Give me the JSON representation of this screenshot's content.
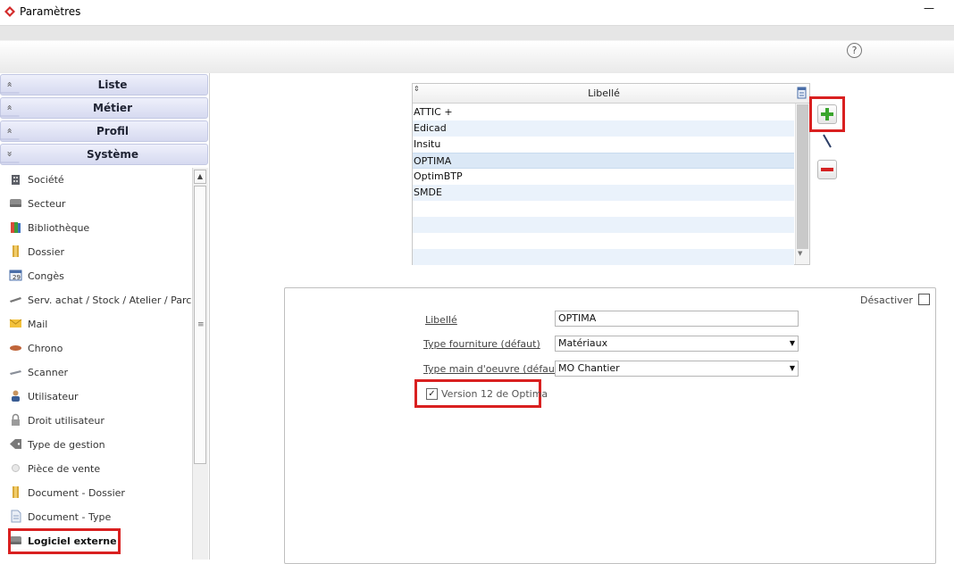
{
  "window": {
    "title": "Paramètres",
    "minimize_glyph": "—"
  },
  "toolbar": {
    "help_glyph": "?"
  },
  "accordion": [
    {
      "label": "Liste",
      "chevron": "«"
    },
    {
      "label": "Métier",
      "chevron": "«"
    },
    {
      "label": "Profil",
      "chevron": "«"
    },
    {
      "label": "Système",
      "chevron": "»"
    }
  ],
  "nav": {
    "items": [
      {
        "label": "Société",
        "icon": "building-icon"
      },
      {
        "label": "Secteur",
        "icon": "drive-icon"
      },
      {
        "label": "Bibliothèque",
        "icon": "books-icon"
      },
      {
        "label": "Dossier",
        "icon": "folder-icon"
      },
      {
        "label": "Congès",
        "icon": "calendar-icon"
      },
      {
        "label": "Serv. achat / Stock / Atelier / Parc",
        "icon": "tools-icon"
      },
      {
        "label": "Mail",
        "icon": "envelope-icon"
      },
      {
        "label": "Chrono",
        "icon": "chrono-icon"
      },
      {
        "label": "Scanner",
        "icon": "scanner-icon"
      },
      {
        "label": "Utilisateur",
        "icon": "user-icon"
      },
      {
        "label": "Droit utilisateur",
        "icon": "lock-icon"
      },
      {
        "label": "Type de gestion",
        "icon": "tag-icon"
      },
      {
        "label": "Pièce de vente",
        "icon": "coin-icon"
      },
      {
        "label": "Document - Dossier",
        "icon": "folder-icon"
      },
      {
        "label": "Document - Type",
        "icon": "document-icon"
      },
      {
        "label": "Logiciel externe",
        "icon": "drive-icon"
      }
    ],
    "active_index": 15
  },
  "grid": {
    "column": "Libellé",
    "sort_glyph": "⇕",
    "rows": [
      "ATTIC +",
      "Edicad",
      "Insitu",
      "OPTIMA",
      "OptimBTP",
      "SMDE",
      "",
      "",
      "",
      ""
    ],
    "selected_index": 3
  },
  "actions": {
    "add": "add",
    "edit": "edit",
    "remove": "remove"
  },
  "form": {
    "disable_label": "Désactiver",
    "disable_checked": false,
    "libelle_label": "Libellé",
    "libelle_value": "OPTIMA",
    "type_fourniture_label": "Type fourniture (défaut)",
    "type_fourniture_value": "Matériaux",
    "type_main_oeuvre_label": "Type main d'oeuvre (défaut)",
    "type_main_oeuvre_value": "MO Chantier",
    "version12_label": "Version 12 de Optima",
    "version12_checked": true,
    "checkmark": "✓",
    "dropdown_glyph": "▼"
  },
  "colors": {
    "highlight": "#d92020",
    "add_green": "#3aa52d",
    "remove_red": "#d52121",
    "accordion": "#d6daf0"
  }
}
